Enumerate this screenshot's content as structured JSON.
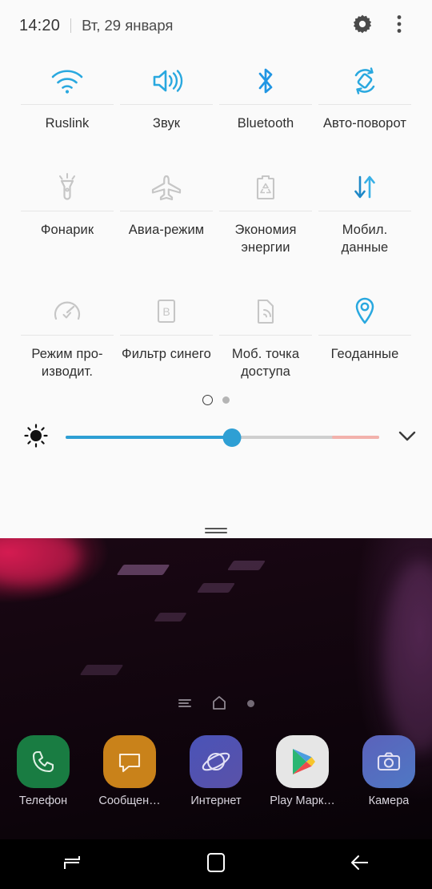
{
  "statusbar": {
    "time": "14:20",
    "date": "Вт, 29 января",
    "settings_icon": "gear-icon",
    "overflow_icon": "more-vertical-icon"
  },
  "quick_settings": {
    "rows": [
      [
        {
          "label": "Ruslink",
          "icon": "wifi-icon",
          "active": true
        },
        {
          "label": "Звук",
          "icon": "sound-icon",
          "active": true
        },
        {
          "label": "Bluetooth",
          "icon": "bluetooth-icon",
          "active": true
        },
        {
          "label": "Авто-поворот",
          "icon": "auto-rotate-icon",
          "active": true
        }
      ],
      [
        {
          "label": "Фонарик",
          "icon": "flashlight-icon",
          "active": false
        },
        {
          "label": "Авиа-режим",
          "icon": "airplane-icon",
          "active": false
        },
        {
          "label": "Экономия энергии",
          "icon": "battery-saver-icon",
          "active": false
        },
        {
          "label": "Мобил. данные",
          "icon": "mobile-data-icon",
          "active": true
        }
      ],
      [
        {
          "label": "Режим про-изводит.",
          "icon": "performance-icon",
          "active": false
        },
        {
          "label": "Фильтр синего",
          "icon": "blue-light-filter-icon",
          "active": false
        },
        {
          "label": "Моб. точка доступа",
          "icon": "hotspot-icon",
          "active": false
        },
        {
          "label": "Геоданные",
          "icon": "location-pin-icon",
          "active": true
        }
      ]
    ],
    "page_indicator": {
      "pages": 2,
      "current": 1
    },
    "brightness": {
      "value_percent": 53,
      "icon": "brightness-icon",
      "expand_icon": "chevron-down-icon"
    },
    "panel_handle": "drag-handle"
  },
  "home": {
    "page_indicators": [
      "bixby-page-icon",
      "home-page-icon",
      "app-page-dot"
    ],
    "dock": [
      {
        "label": "Телефон",
        "icon": "phone-icon",
        "color": "#197c42"
      },
      {
        "label": "Сообщен…",
        "icon": "messages-icon",
        "color": "#c9821a"
      },
      {
        "label": "Интернет",
        "icon": "internet-icon",
        "color": "#4a53b8"
      },
      {
        "label": "Play Марк…",
        "icon": "play-store-icon",
        "color": "#e3e3e3"
      },
      {
        "label": "Камера",
        "icon": "camera-icon",
        "color": "#5b62bb"
      }
    ]
  },
  "navbar": [
    {
      "name": "recents",
      "icon": "recents-icon"
    },
    {
      "name": "home",
      "icon": "home-square-icon"
    },
    {
      "name": "back",
      "icon": "back-arrow-icon"
    }
  ],
  "colors": {
    "accent_blue": "#2e9fd4",
    "bluetooth_blue": "#2196e3",
    "inactive_gray": "#c6c6c6",
    "panel_bg": "#fafafa",
    "text_dark": "#2f2f2f"
  }
}
